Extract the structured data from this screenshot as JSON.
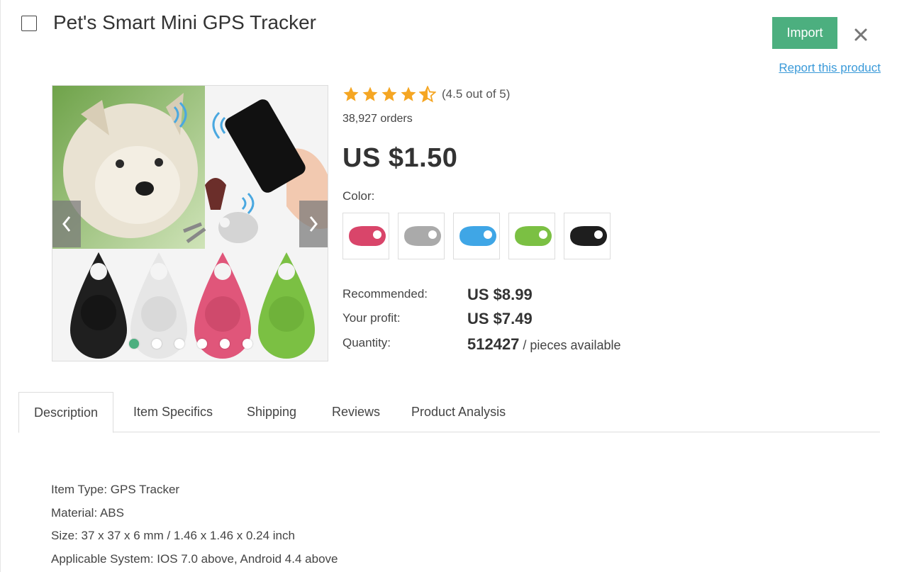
{
  "product": {
    "title": "Pet's Smart Mini GPS Tracker",
    "rating_text": "(4.5 out of 5)",
    "rating_value": 4.5,
    "orders": "38,927 orders",
    "price": "US $1.50",
    "color_label": "Color:"
  },
  "header": {
    "import_label": "Import",
    "report_label": "Report this product"
  },
  "swatches": [
    {
      "name": "red",
      "color": "#d9456a"
    },
    {
      "name": "gray",
      "color": "#aaaaaa"
    },
    {
      "name": "blue",
      "color": "#3fa6e6"
    },
    {
      "name": "green",
      "color": "#7bc043"
    },
    {
      "name": "black",
      "color": "#1e1e1e"
    }
  ],
  "pricing": {
    "recommended_label": "Recommended:",
    "recommended_value": "US $8.99",
    "profit_label": "Your profit:",
    "profit_value": "US $7.49",
    "quantity_label": "Quantity:",
    "quantity_value": "512427",
    "quantity_suffix": " / pieces available"
  },
  "tabs": [
    {
      "label": "Description",
      "active": true
    },
    {
      "label": "Item Specifics",
      "active": false
    },
    {
      "label": "Shipping",
      "active": false
    },
    {
      "label": "Reviews",
      "active": false
    },
    {
      "label": "Product Analysis",
      "active": false
    }
  ],
  "description": [
    "Item Type: GPS Tracker",
    "Material: ABS",
    "Size: 37 x 37 x 6 mm / 1.46 x 1.46 x 0.24 inch",
    "Applicable System: IOS 7.0 above, Android 4.4 above"
  ],
  "colors": {
    "accent": "#4caf7f",
    "link": "#3a9ad9",
    "star": "#f5a623"
  }
}
